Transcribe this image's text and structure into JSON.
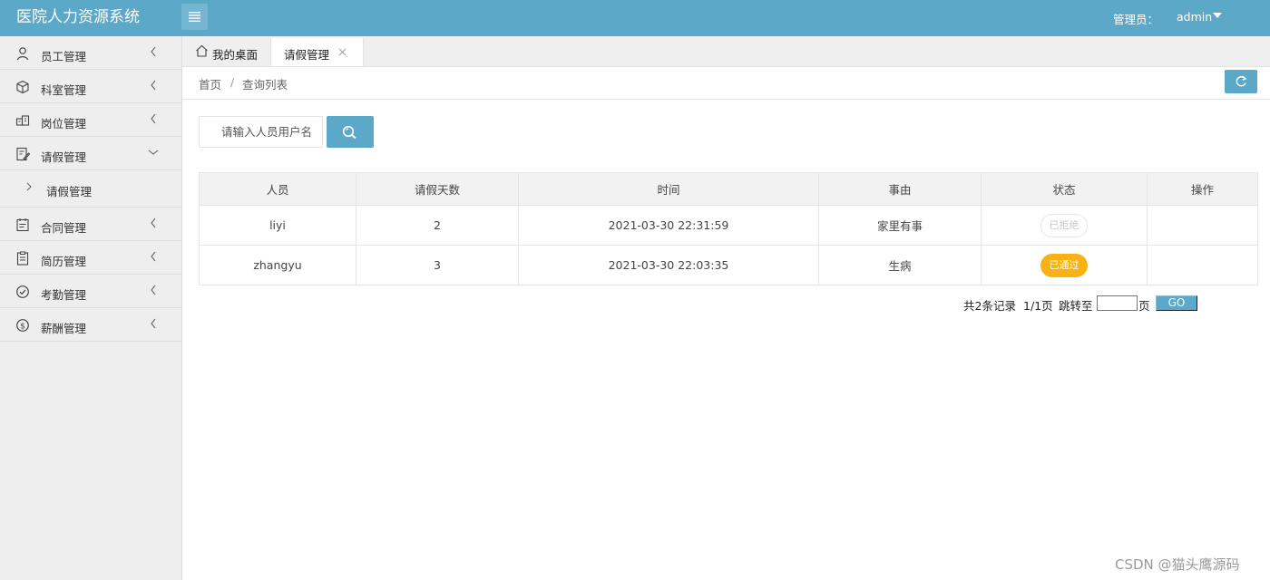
{
  "header": {
    "app_title": "医院人力资源系统",
    "admin_label": "管理员：",
    "admin_name": "admin",
    "brand_color": "#5ba8c8"
  },
  "sidebar": {
    "items": [
      {
        "label": "员工管理",
        "icon": "user-icon",
        "expanded": false
      },
      {
        "label": "科室管理",
        "icon": "cube-icon",
        "expanded": false
      },
      {
        "label": "岗位管理",
        "icon": "building-icon",
        "expanded": false
      },
      {
        "label": "请假管理",
        "icon": "note-edit-icon",
        "expanded": true,
        "children": [
          {
            "label": "请假管理"
          }
        ]
      },
      {
        "label": "合同管理",
        "icon": "contract-icon",
        "expanded": false
      },
      {
        "label": "简历管理",
        "icon": "resume-icon",
        "expanded": false
      },
      {
        "label": "考勤管理",
        "icon": "check-circle-icon",
        "expanded": false
      },
      {
        "label": "薪酬管理",
        "icon": "dollar-circle-icon",
        "expanded": false
      }
    ]
  },
  "tabs": {
    "home_label": "我的桌面",
    "active_label": "请假管理"
  },
  "breadcrumb": {
    "home": "首页",
    "separator": "/",
    "current": "查询列表"
  },
  "search": {
    "placeholder": "请输入人员用户名"
  },
  "table": {
    "headers": [
      "人员",
      "请假天数",
      "时间",
      "事由",
      "状态",
      "操作"
    ],
    "rows": [
      {
        "person": "liyi",
        "days": "2",
        "time": "2021-03-30 22:31:59",
        "reason": "家里有事",
        "status": "已拒绝",
        "status_type": "rejected",
        "action": ""
      },
      {
        "person": "zhangyu",
        "days": "3",
        "time": "2021-03-30 22:03:35",
        "reason": "生病",
        "status": "已通过",
        "status_type": "approved",
        "action": ""
      }
    ]
  },
  "pager": {
    "total": "共2条记录",
    "pages": "1/1页",
    "jump_label": "跳转至",
    "page_suffix": "页",
    "go_label": "GO"
  },
  "watermark": "CSDN @猫头鹰源码"
}
